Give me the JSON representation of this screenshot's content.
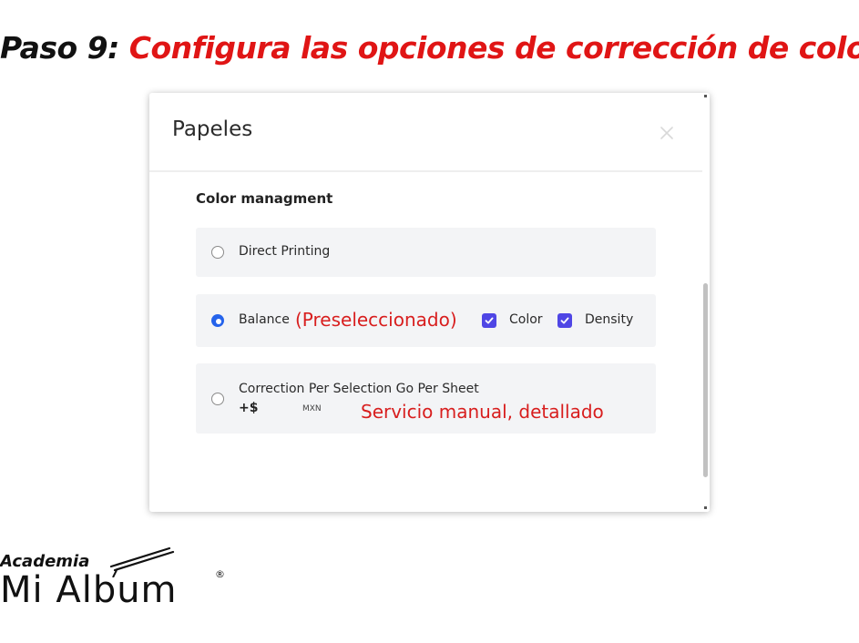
{
  "heading": {
    "prefix": "Paso 9: ",
    "title": "Configura las opciones de corrección de color"
  },
  "modal": {
    "title": "Papeles",
    "close_icon": "close-icon",
    "section_label": "Color managment",
    "options": [
      {
        "label": "Direct Printing",
        "selected": false
      },
      {
        "label": "Balance",
        "selected": true,
        "annotation": "(Preseleccionado)",
        "checkboxes": [
          {
            "label": "Color",
            "checked": true
          },
          {
            "label": "Density",
            "checked": true
          }
        ]
      },
      {
        "label": "Correction Per Selection Go Per Sheet",
        "selected": false,
        "price": "+$",
        "currency": "MXN",
        "annotation": "Servicio manual, detallado"
      }
    ]
  },
  "colors": {
    "heading_accent": "#e01515",
    "annotation": "#d81e1e",
    "radio_selected": "#2563eb",
    "checkbox": "#4f46e5",
    "option_bg": "#f3f4f6"
  },
  "logo": {
    "top_line": "Academia",
    "main_line": "Mi Album",
    "registered": "®"
  }
}
